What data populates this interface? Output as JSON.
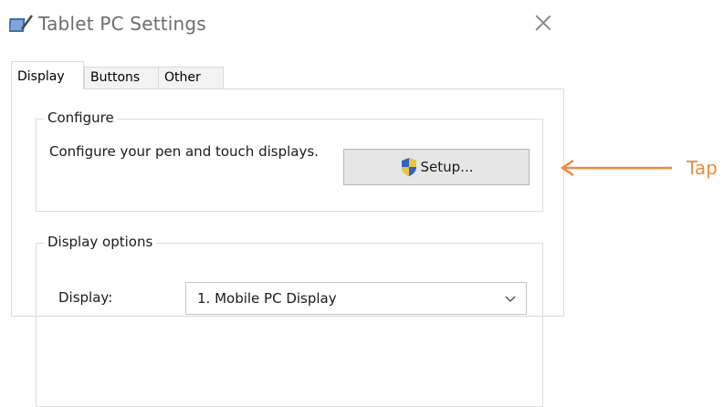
{
  "window": {
    "title": "Tablet PC Settings",
    "icon": "tablet-pen-icon"
  },
  "tabs": [
    {
      "label": "Display",
      "active": true
    },
    {
      "label": "Buttons",
      "active": false
    },
    {
      "label": "Other",
      "active": false
    }
  ],
  "configure": {
    "legend": "Configure",
    "description": "Configure your pen and touch displays.",
    "setup_label": "Setup...",
    "setup_icon": "uac-shield-icon"
  },
  "display_options": {
    "legend": "Display options",
    "display_label": "Display:",
    "display_value": "1. Mobile PC Display"
  },
  "annotation": {
    "text": "Tap",
    "color": "#f08a3c"
  }
}
